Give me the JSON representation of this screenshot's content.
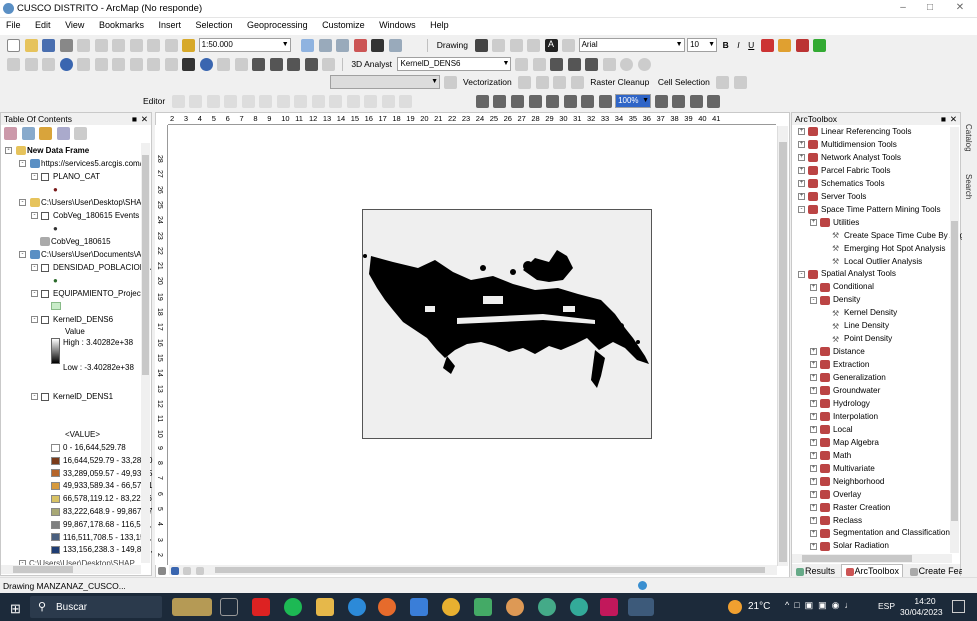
{
  "window": {
    "title": "CUSCO DISTRITO - ArcMap (No responde)"
  },
  "menu": [
    "File",
    "Edit",
    "View",
    "Bookmarks",
    "Insert",
    "Selection",
    "Geoprocessing",
    "Customize",
    "Windows",
    "Help"
  ],
  "toolbar1": {
    "scale": "1:50.000",
    "drawing_label": "Drawing",
    "font": "Arial",
    "font_size": "10",
    "bold": "B",
    "italic": "I",
    "underline": "U"
  },
  "toolbar2": {
    "analyst": "3D Analyst",
    "layer": "KernelD_DENS6",
    "vectorization": "Vectorization",
    "raster_cleanup": "Raster Cleanup",
    "cell_selection": "Cell Selection"
  },
  "toolbar3": {
    "editor": "Editor",
    "zoom": "100%"
  },
  "toc": {
    "title": "Table Of Contents",
    "frame": "New Data Frame",
    "items": [
      {
        "label": "https://services5.arcgis.com/"
      },
      {
        "label": "PLANO_CAT"
      },
      {
        "label": "C:\\Users\\User\\Desktop\\SHAP"
      },
      {
        "label": "CobVeg_180615 Events"
      },
      {
        "label": "CobVeg_180615"
      },
      {
        "label": "C:\\Users\\User\\Documents\\Ar"
      },
      {
        "label": "DENSIDAD_POBLACIONA"
      },
      {
        "label": "EQUIPAMIENTO_Project"
      },
      {
        "label": "KernelD_DENS6"
      },
      {
        "label": "Value"
      },
      {
        "label": "High : 3.40282e+38"
      },
      {
        "label": "Low : -3.40282e+38"
      },
      {
        "label": "KernelD_DENS1"
      },
      {
        "label": "<VALUE>"
      }
    ],
    "legend": [
      {
        "label": "0 - 16,644,529.78",
        "color": "#ffffff"
      },
      {
        "label": "16,644,529.79 - 33,289,0",
        "color": "#7a3b1a"
      },
      {
        "label": "33,289,059.57 - 49,933,5",
        "color": "#b5652b"
      },
      {
        "label": "49,933,589.34 - 66,578,1",
        "color": "#d79a3d"
      },
      {
        "label": "66,578,119.12 - 83,222,6",
        "color": "#d8c264"
      },
      {
        "label": "83,222,648.9 - 99,867,17",
        "color": "#a8a875"
      },
      {
        "label": "99,867,178.68 - 116,511,",
        "color": "#7f8080"
      },
      {
        "label": "116,511,708.5 - 133,156,",
        "color": "#4a5f7e"
      },
      {
        "label": "133,156,238.3 - 149,800,",
        "color": "#1f3d73"
      }
    ],
    "last_item": "C:\\Users\\User\\Desktop\\SHAP"
  },
  "ruler": [
    "2",
    "3",
    "4",
    "5",
    "6",
    "7",
    "8",
    "9",
    "10",
    "11",
    "12",
    "13",
    "14",
    "15",
    "16",
    "17",
    "18",
    "19",
    "20",
    "21",
    "22",
    "23",
    "24",
    "25",
    "26",
    "27",
    "28",
    "29",
    "30",
    "31",
    "32",
    "33",
    "34",
    "35",
    "36",
    "37",
    "38",
    "39",
    "40",
    "41"
  ],
  "ruler_left": [
    "28",
    "27",
    "26",
    "25",
    "24",
    "23",
    "22",
    "21",
    "20",
    "19",
    "18",
    "17",
    "16",
    "15",
    "14",
    "13",
    "12",
    "11",
    "10",
    "9",
    "8",
    "7",
    "6",
    "5",
    "4",
    "3",
    "2"
  ],
  "toolbox": {
    "title": "ArcToolbox",
    "items": [
      {
        "label": "Linear Referencing Tools",
        "level": 0,
        "kind": "box"
      },
      {
        "label": "Multidimension Tools",
        "level": 0,
        "kind": "box"
      },
      {
        "label": "Network Analyst Tools",
        "level": 0,
        "kind": "box"
      },
      {
        "label": "Parcel Fabric Tools",
        "level": 0,
        "kind": "box"
      },
      {
        "label": "Schematics Tools",
        "level": 0,
        "kind": "box"
      },
      {
        "label": "Server Tools",
        "level": 0,
        "kind": "box"
      },
      {
        "label": "Space Time Pattern Mining Tools",
        "level": 0,
        "kind": "box"
      },
      {
        "label": "Utilities",
        "level": 1,
        "kind": "box"
      },
      {
        "label": "Create Space Time Cube By Aggreg",
        "level": 2,
        "kind": "tool"
      },
      {
        "label": "Emerging Hot Spot Analysis",
        "level": 2,
        "kind": "tool"
      },
      {
        "label": "Local Outlier Analysis",
        "level": 2,
        "kind": "tool"
      },
      {
        "label": "Spatial Analyst Tools",
        "level": 0,
        "kind": "box"
      },
      {
        "label": "Conditional",
        "level": 1,
        "kind": "box"
      },
      {
        "label": "Density",
        "level": 1,
        "kind": "box"
      },
      {
        "label": "Kernel Density",
        "level": 2,
        "kind": "tool"
      },
      {
        "label": "Line Density",
        "level": 2,
        "kind": "tool"
      },
      {
        "label": "Point Density",
        "level": 2,
        "kind": "tool"
      },
      {
        "label": "Distance",
        "level": 1,
        "kind": "box"
      },
      {
        "label": "Extraction",
        "level": 1,
        "kind": "box"
      },
      {
        "label": "Generalization",
        "level": 1,
        "kind": "box"
      },
      {
        "label": "Groundwater",
        "level": 1,
        "kind": "box"
      },
      {
        "label": "Hydrology",
        "level": 1,
        "kind": "box"
      },
      {
        "label": "Interpolation",
        "level": 1,
        "kind": "box"
      },
      {
        "label": "Local",
        "level": 1,
        "kind": "box"
      },
      {
        "label": "Map Algebra",
        "level": 1,
        "kind": "box"
      },
      {
        "label": "Math",
        "level": 1,
        "kind": "box"
      },
      {
        "label": "Multivariate",
        "level": 1,
        "kind": "box"
      },
      {
        "label": "Neighborhood",
        "level": 1,
        "kind": "box"
      },
      {
        "label": "Overlay",
        "level": 1,
        "kind": "box"
      },
      {
        "label": "Raster Creation",
        "level": 1,
        "kind": "box"
      },
      {
        "label": "Reclass",
        "level": 1,
        "kind": "box"
      },
      {
        "label": "Segmentation and Classification",
        "level": 1,
        "kind": "box"
      },
      {
        "label": "Solar Radiation",
        "level": 1,
        "kind": "box"
      }
    ],
    "tabs": [
      "Results",
      "ArcToolbox",
      "Create Features"
    ]
  },
  "side_tabs": [
    "Catalog",
    "Search"
  ],
  "status": {
    "text": "Drawing MANZANAZ_CUSCO..."
  },
  "taskbar": {
    "search": "Buscar",
    "temp": "21°C",
    "lang": "ESP",
    "time": "14:20",
    "date": "30/04/2023"
  }
}
